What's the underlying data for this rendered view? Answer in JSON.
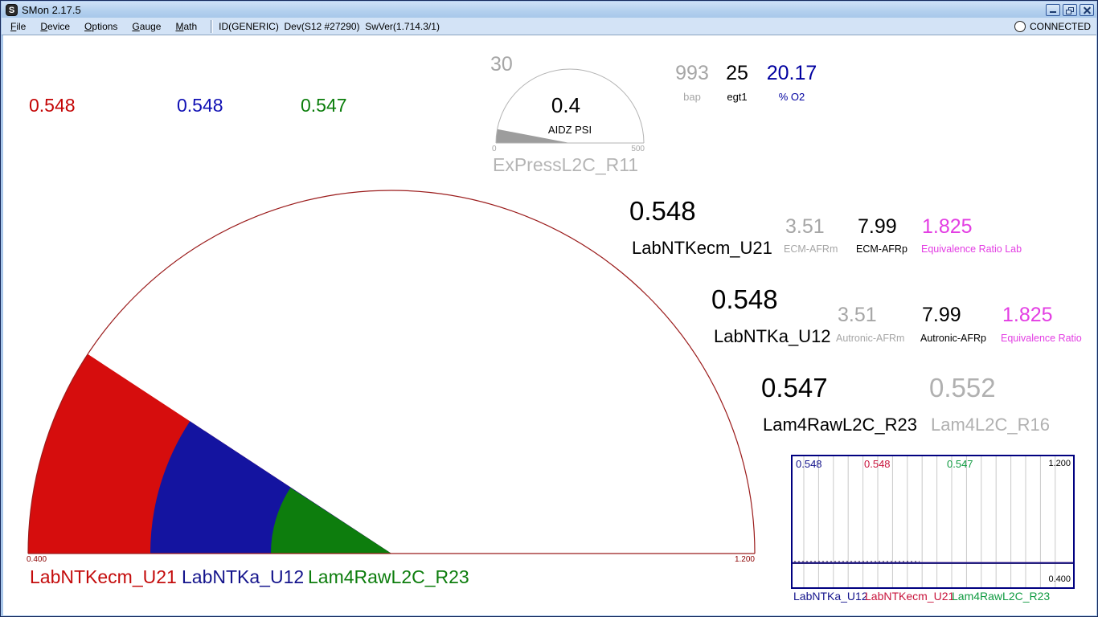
{
  "window": {
    "title": "SMon 2.17.5"
  },
  "menu": {
    "items": [
      {
        "label": "File"
      },
      {
        "label": "Device"
      },
      {
        "label": "Options"
      },
      {
        "label": "Gauge"
      },
      {
        "label": "Math"
      }
    ],
    "device_info": "ID(GENERIC)  Dev(S12 #27290)  SwVer(1.714.3/1)",
    "status": "CONNECTED"
  },
  "quick_values": [
    {
      "value": "0.548",
      "color": "#c40505"
    },
    {
      "value": "0.548",
      "color": "#1010b4"
    },
    {
      "value": "0.547",
      "color": "#0a7d0a"
    }
  ],
  "env_readouts": [
    {
      "value": "993",
      "label": "bap",
      "color": "#a6a6a6"
    },
    {
      "value": "25",
      "label": "egt1",
      "color": "#000000"
    },
    {
      "value": "20.17",
      "label": "% O2",
      "color": "#0000a0"
    }
  ],
  "readout_rows": [
    {
      "value": "0.548",
      "name": "LabNTKecm_U21",
      "subs": [
        {
          "value": "3.51",
          "label": "ECM-AFRm",
          "color": "#a6a6a6"
        },
        {
          "value": "7.99",
          "label": "ECM-AFRp",
          "color": "#000000"
        },
        {
          "value": "1.825",
          "label": "Equivalence Ratio Lab",
          "color": "#e33ee3"
        }
      ]
    },
    {
      "value": "0.548",
      "name": "LabNTKa_U12",
      "subs": [
        {
          "value": "3.51",
          "label": "Autronic-AFRm",
          "color": "#a6a6a6"
        },
        {
          "value": "7.99",
          "label": "Autronic-AFRp",
          "color": "#000000"
        },
        {
          "value": "1.825",
          "label": "Equivalence Ratio",
          "color": "#e33ee3"
        }
      ]
    },
    {
      "value": "0.547",
      "name": "Lam4RawL2C_R23",
      "secondary": {
        "value": "0.552",
        "name": "Lam4L2C_R16",
        "color": "#b0b0b0"
      }
    }
  ],
  "chart_data": [
    {
      "id": "press_gauge",
      "type": "gauge",
      "title": "ExPressL2C_R11",
      "value": 0.4,
      "value_label": "0.4",
      "peak_label": "30",
      "units": "AIDZ PSI",
      "min": 0,
      "max": 500,
      "min_label": "0",
      "max_label": "500",
      "needle_fraction": 0.06,
      "needle_color": "#9d9d9d",
      "arc_color": "#b3b3b3"
    },
    {
      "id": "lambda_gauge",
      "type": "gauge",
      "min": 0.4,
      "max": 1.2,
      "min_label": "0.400",
      "max_label": "1.200",
      "arc_color": "#9b1c1c",
      "needles": [
        {
          "name": "LabNTKecm_U21",
          "value": 0.548,
          "color": "#d60d0d",
          "legend_color": "#c40c0c",
          "radius": 452
        },
        {
          "name": "LabNTKa_U12",
          "value": 0.548,
          "color": "#1414a0",
          "legend_color": "#14148c",
          "radius": 300
        },
        {
          "name": "Lam4RawL2C_R23",
          "value": 0.547,
          "color": "#0d7d0d",
          "legend_color": "#0d7d0d",
          "radius": 150
        }
      ]
    },
    {
      "id": "strip_chart",
      "type": "line",
      "ylim": [
        0.4,
        1.2
      ],
      "ymax_label": "1.200",
      "ymin_label": "0.400",
      "grid": true,
      "border_color": "#000080",
      "grid_color": "#c9c9c9",
      "series": [
        {
          "name": "LabNTKa_U12",
          "value": 0.548,
          "value_label": "0.548",
          "color": "#14148c"
        },
        {
          "name": "LabNTKecm_U21",
          "value": 0.548,
          "value_label": "0.548",
          "color": "#c8143c"
        },
        {
          "name": "Lam4RawL2C_R23",
          "value": 0.547,
          "value_label": "0.547",
          "color": "#0f9a40"
        }
      ]
    }
  ]
}
